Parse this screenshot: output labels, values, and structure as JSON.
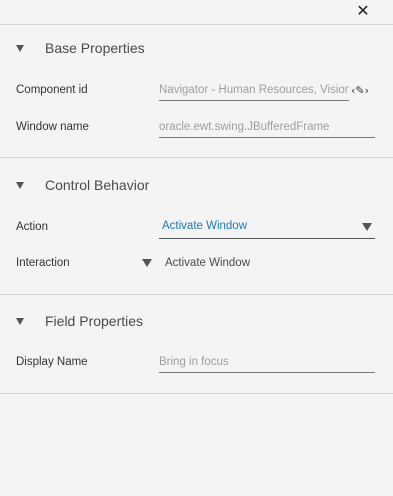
{
  "header": {
    "close_glyph": "✕"
  },
  "base": {
    "title": "Base Properties",
    "component_id_label": "Component id",
    "component_id_value": "Navigator - Human Resources, Vision Enterprises",
    "edit_glyph": "‹✎›",
    "window_name_label": "Window name",
    "window_name_value": "oracle.ewt.swing.JBufferedFrame"
  },
  "control": {
    "title": "Control Behavior",
    "action_label": "Action",
    "action_value": "Activate Window",
    "interaction_label": "Interaction",
    "interaction_value": "Activate Window"
  },
  "field": {
    "title": "Field Properties",
    "display_name_label": "Display Name",
    "display_name_placeholder": "Bring in focus"
  },
  "colors": {
    "accent": "#1e7ab8",
    "background": "#f4f4f4",
    "divider": "#d6d6d6"
  }
}
